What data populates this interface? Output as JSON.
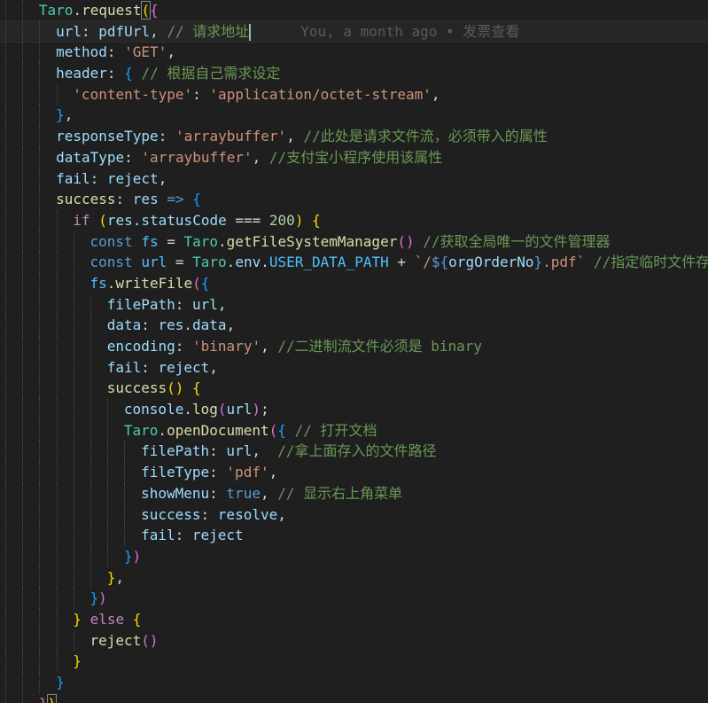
{
  "editor": {
    "language": "javascript",
    "blame": "You, a month ago • 发票查看",
    "lines": [
      {
        "indent": 2,
        "tokens": [
          [
            "t-class",
            "Taro"
          ],
          [
            "t-punc",
            "."
          ],
          [
            "t-fn",
            "request"
          ],
          [
            "b1 bracket-match",
            "("
          ],
          [
            "b2",
            "{"
          ]
        ]
      },
      {
        "indent": 3,
        "active": true,
        "blame": true,
        "tokens": [
          [
            "t-var",
            "url"
          ],
          [
            "t-punc",
            ": "
          ],
          [
            "t-var",
            "pdfUrl"
          ],
          [
            "t-punc",
            ", "
          ],
          [
            "t-cmt",
            "// 请求地址"
          ],
          [
            "cursor",
            ""
          ]
        ]
      },
      {
        "indent": 3,
        "tokens": [
          [
            "t-var",
            "method"
          ],
          [
            "t-punc",
            ": "
          ],
          [
            "t-str",
            "'GET'"
          ],
          [
            "t-punc",
            ","
          ]
        ]
      },
      {
        "indent": 3,
        "tokens": [
          [
            "t-var",
            "header"
          ],
          [
            "t-punc",
            ": "
          ],
          [
            "b3",
            "{"
          ],
          [
            "t-punc",
            " "
          ],
          [
            "t-cmt",
            "// 根据自己需求设定"
          ]
        ]
      },
      {
        "indent": 4,
        "tokens": [
          [
            "t-str",
            "'content-type'"
          ],
          [
            "t-punc",
            ": "
          ],
          [
            "t-str",
            "'application/octet-stream'"
          ],
          [
            "t-punc",
            ","
          ]
        ]
      },
      {
        "indent": 3,
        "tokens": [
          [
            "b3",
            "}"
          ],
          [
            "t-punc",
            ","
          ]
        ]
      },
      {
        "indent": 3,
        "tokens": [
          [
            "t-var",
            "responseType"
          ],
          [
            "t-punc",
            ": "
          ],
          [
            "t-str",
            "'arraybuffer'"
          ],
          [
            "t-punc",
            ", "
          ],
          [
            "t-cmt",
            "//此处是请求文件流，必须带入的属性"
          ]
        ]
      },
      {
        "indent": 3,
        "tokens": [
          [
            "t-var",
            "dataType"
          ],
          [
            "t-punc",
            ": "
          ],
          [
            "t-str",
            "'arraybuffer'"
          ],
          [
            "t-punc",
            ", "
          ],
          [
            "t-cmt",
            "//支付宝小程序使用该属性"
          ]
        ]
      },
      {
        "indent": 3,
        "tokens": [
          [
            "t-var",
            "fail"
          ],
          [
            "t-punc",
            ": "
          ],
          [
            "t-var",
            "reject"
          ],
          [
            "t-punc",
            ","
          ]
        ]
      },
      {
        "indent": 3,
        "tokens": [
          [
            "t-fn",
            "success"
          ],
          [
            "t-punc",
            ": "
          ],
          [
            "t-var",
            "res"
          ],
          [
            "t-punc",
            " "
          ],
          [
            "t-kw",
            "=>"
          ],
          [
            "t-punc",
            " "
          ],
          [
            "b3",
            "{"
          ]
        ]
      },
      {
        "indent": 4,
        "tokens": [
          [
            "t-ctrl",
            "if"
          ],
          [
            "t-punc",
            " "
          ],
          [
            "b1",
            "("
          ],
          [
            "t-var",
            "res"
          ],
          [
            "t-punc",
            "."
          ],
          [
            "t-var",
            "statusCode"
          ],
          [
            "t-punc",
            " "
          ],
          [
            "t-op",
            "==="
          ],
          [
            "t-punc",
            " "
          ],
          [
            "t-num",
            "200"
          ],
          [
            "b1",
            ")"
          ],
          [
            "t-punc",
            " "
          ],
          [
            "b1",
            "{"
          ]
        ]
      },
      {
        "indent": 5,
        "tokens": [
          [
            "t-kw",
            "const"
          ],
          [
            "t-punc",
            " "
          ],
          [
            "t-const",
            "fs"
          ],
          [
            "t-punc",
            " "
          ],
          [
            "t-op",
            "="
          ],
          [
            "t-punc",
            " "
          ],
          [
            "t-class",
            "Taro"
          ],
          [
            "t-punc",
            "."
          ],
          [
            "t-fn",
            "getFileSystemManager"
          ],
          [
            "b2",
            "()"
          ],
          [
            "t-punc",
            " "
          ],
          [
            "t-cmt",
            "//获取全局唯一的文件管理器"
          ]
        ]
      },
      {
        "indent": 5,
        "tokens": [
          [
            "t-kw",
            "const"
          ],
          [
            "t-punc",
            " "
          ],
          [
            "t-const",
            "url"
          ],
          [
            "t-punc",
            " "
          ],
          [
            "t-op",
            "="
          ],
          [
            "t-punc",
            " "
          ],
          [
            "t-class",
            "Taro"
          ],
          [
            "t-punc",
            "."
          ],
          [
            "t-var",
            "env"
          ],
          [
            "t-punc",
            "."
          ],
          [
            "t-const",
            "USER_DATA_PATH"
          ],
          [
            "t-punc",
            " "
          ],
          [
            "t-op",
            "+"
          ],
          [
            "t-punc",
            " "
          ],
          [
            "t-str",
            "`/"
          ],
          [
            "t-kw",
            "${"
          ],
          [
            "t-var",
            "orgOrderNo"
          ],
          [
            "t-kw",
            "}"
          ],
          [
            "t-str",
            ".pdf`"
          ],
          [
            "t-punc",
            " "
          ],
          [
            "t-cmt",
            "//指定临时文件存"
          ]
        ]
      },
      {
        "indent": 5,
        "tokens": [
          [
            "t-const",
            "fs"
          ],
          [
            "t-punc",
            "."
          ],
          [
            "t-fn",
            "writeFile"
          ],
          [
            "b2",
            "("
          ],
          [
            "b3",
            "{"
          ]
        ]
      },
      {
        "indent": 6,
        "tokens": [
          [
            "t-var",
            "filePath"
          ],
          [
            "t-punc",
            ": "
          ],
          [
            "t-var",
            "url"
          ],
          [
            "t-punc",
            ","
          ]
        ]
      },
      {
        "indent": 6,
        "tokens": [
          [
            "t-var",
            "data"
          ],
          [
            "t-punc",
            ": "
          ],
          [
            "t-var",
            "res"
          ],
          [
            "t-punc",
            "."
          ],
          [
            "t-var",
            "data"
          ],
          [
            "t-punc",
            ","
          ]
        ]
      },
      {
        "indent": 6,
        "tokens": [
          [
            "t-var",
            "encoding"
          ],
          [
            "t-punc",
            ": "
          ],
          [
            "t-str",
            "'binary'"
          ],
          [
            "t-punc",
            ", "
          ],
          [
            "t-cmt",
            "//二进制流文件必须是 binary"
          ]
        ]
      },
      {
        "indent": 6,
        "tokens": [
          [
            "t-var",
            "fail"
          ],
          [
            "t-punc",
            ": "
          ],
          [
            "t-var",
            "reject"
          ],
          [
            "t-punc",
            ","
          ]
        ]
      },
      {
        "indent": 6,
        "tokens": [
          [
            "t-fn",
            "success"
          ],
          [
            "b1",
            "()"
          ],
          [
            "t-punc",
            " "
          ],
          [
            "b1",
            "{"
          ]
        ]
      },
      {
        "indent": 7,
        "tokens": [
          [
            "t-var",
            "console"
          ],
          [
            "t-punc",
            "."
          ],
          [
            "t-fn",
            "log"
          ],
          [
            "b2",
            "("
          ],
          [
            "t-var",
            "url"
          ],
          [
            "b2",
            ")"
          ],
          [
            "t-punc",
            ";"
          ]
        ]
      },
      {
        "indent": 7,
        "tokens": [
          [
            "t-class",
            "Taro"
          ],
          [
            "t-punc",
            "."
          ],
          [
            "t-fn",
            "openDocument"
          ],
          [
            "b2",
            "("
          ],
          [
            "b3",
            "{"
          ],
          [
            "t-punc",
            " "
          ],
          [
            "t-cmt",
            "// 打开文档"
          ]
        ]
      },
      {
        "indent": 8,
        "tokens": [
          [
            "t-var",
            "filePath"
          ],
          [
            "t-punc",
            ": "
          ],
          [
            "t-var",
            "url"
          ],
          [
            "t-punc",
            ",  "
          ],
          [
            "t-cmt",
            "//拿上面存入的文件路径"
          ]
        ]
      },
      {
        "indent": 8,
        "tokens": [
          [
            "t-var",
            "fileType"
          ],
          [
            "t-punc",
            ": "
          ],
          [
            "t-str",
            "'pdf'"
          ],
          [
            "t-punc",
            ","
          ]
        ]
      },
      {
        "indent": 8,
        "tokens": [
          [
            "t-var",
            "showMenu"
          ],
          [
            "t-punc",
            ": "
          ],
          [
            "t-kw",
            "true"
          ],
          [
            "t-punc",
            ", "
          ],
          [
            "t-cmt",
            "// 显示右上角菜单"
          ]
        ]
      },
      {
        "indent": 8,
        "tokens": [
          [
            "t-var",
            "success"
          ],
          [
            "t-punc",
            ": "
          ],
          [
            "t-var",
            "resolve"
          ],
          [
            "t-punc",
            ","
          ]
        ]
      },
      {
        "indent": 8,
        "tokens": [
          [
            "t-var",
            "fail"
          ],
          [
            "t-punc",
            ": "
          ],
          [
            "t-var",
            "reject"
          ]
        ]
      },
      {
        "indent": 7,
        "tokens": [
          [
            "b3",
            "}"
          ],
          [
            "b2",
            ")"
          ]
        ]
      },
      {
        "indent": 6,
        "tokens": [
          [
            "b1",
            "}"
          ],
          [
            "t-punc",
            ","
          ]
        ]
      },
      {
        "indent": 5,
        "tokens": [
          [
            "b3",
            "}"
          ],
          [
            "b2",
            ")"
          ]
        ]
      },
      {
        "indent": 4,
        "tokens": [
          [
            "b1",
            "}"
          ],
          [
            "t-punc",
            " "
          ],
          [
            "t-ctrl",
            "else"
          ],
          [
            "t-punc",
            " "
          ],
          [
            "b1",
            "{"
          ]
        ]
      },
      {
        "indent": 5,
        "tokens": [
          [
            "t-fn",
            "reject"
          ],
          [
            "b2",
            "()"
          ]
        ]
      },
      {
        "indent": 4,
        "tokens": [
          [
            "b1",
            "}"
          ]
        ]
      },
      {
        "indent": 3,
        "tokens": [
          [
            "b3",
            "}"
          ]
        ]
      },
      {
        "indent": 2,
        "tokens": [
          [
            "b2",
            "}"
          ],
          [
            "b1 bracket-match",
            ")"
          ]
        ]
      }
    ]
  }
}
